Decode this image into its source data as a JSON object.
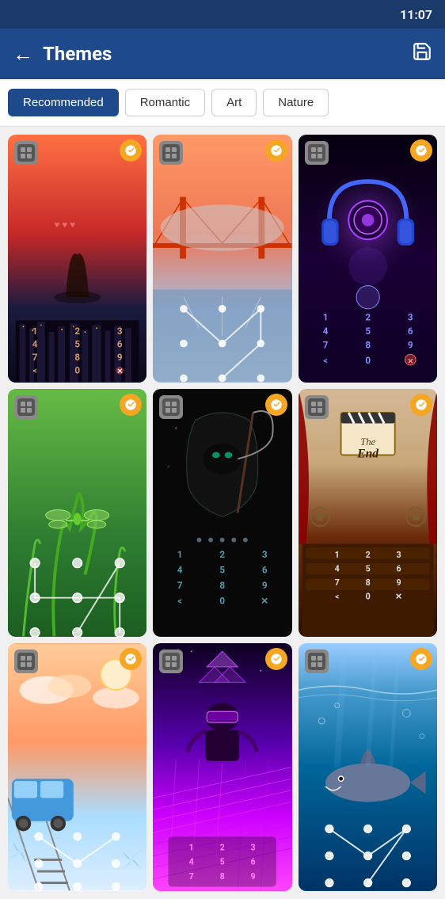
{
  "statusBar": {
    "time": "11:07"
  },
  "header": {
    "title": "Themes",
    "backLabel": "←",
    "saveIconLabel": "save"
  },
  "filters": {
    "items": [
      {
        "label": "Recommended",
        "active": true
      },
      {
        "label": "Romantic",
        "active": false
      },
      {
        "label": "Art",
        "active": false
      },
      {
        "label": "Nature",
        "active": false
      }
    ]
  },
  "themes": [
    {
      "id": 1,
      "name": "Romantic Cityscape",
      "type": "numpad",
      "bg": "romantic-city"
    },
    {
      "id": 2,
      "name": "Golden Gate Bridge",
      "type": "pattern",
      "bg": "golden-gate"
    },
    {
      "id": 3,
      "name": "Neon Headphones",
      "type": "numpad",
      "bg": "neon-headphones"
    },
    {
      "id": 4,
      "name": "Nature Dragonfly",
      "type": "pattern",
      "bg": "nature-green"
    },
    {
      "id": 5,
      "name": "Dark Reaper",
      "type": "numpad",
      "bg": "dark-reaper"
    },
    {
      "id": 6,
      "name": "The End Theater",
      "type": "numpad",
      "bg": "theater"
    },
    {
      "id": 7,
      "name": "Train Journey",
      "type": "pattern",
      "bg": "train"
    },
    {
      "id": 8,
      "name": "Neon Gamer",
      "type": "numpad",
      "bg": "neon-gamer"
    },
    {
      "id": 9,
      "name": "Ocean Shark",
      "type": "pattern",
      "bg": "ocean"
    }
  ],
  "numpadKeys": [
    "1",
    "2",
    "3",
    "4",
    "5",
    "6",
    "7",
    "8",
    "9",
    "<",
    "0",
    "×"
  ],
  "colors": {
    "headerBg": "#1e4a8c",
    "activeBadge": "#f5a623",
    "activeFilter": "#1e4a8c"
  }
}
